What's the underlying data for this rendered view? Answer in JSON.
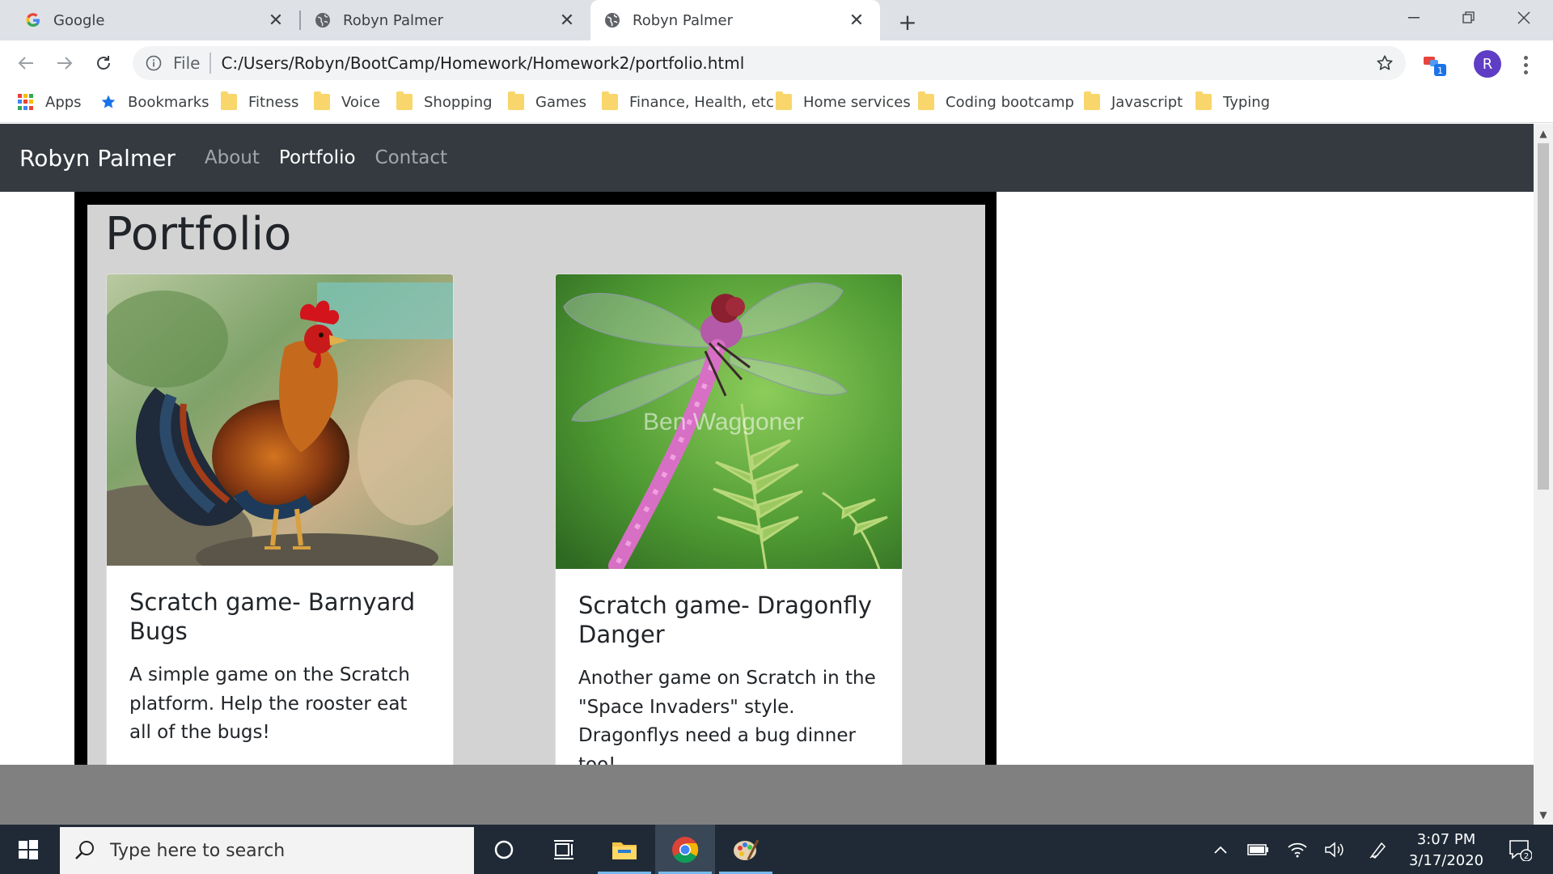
{
  "browser": {
    "tabs": [
      {
        "title": "Google",
        "favicon": "google-icon"
      },
      {
        "title": "Robyn Palmer",
        "favicon": "globe-icon"
      },
      {
        "title": "Robyn Palmer",
        "favicon": "globe-icon",
        "active": true
      }
    ],
    "address": {
      "scheme": "File",
      "url": "C:/Users/Robyn/BootCamp/Homework/Homework2/portfolio.html"
    },
    "profile_initial": "R",
    "extension_badge": "1",
    "bookmarks": [
      {
        "label": "Apps",
        "icon": "apps-grid-icon"
      },
      {
        "label": "Bookmarks",
        "icon": "star-icon"
      },
      {
        "label": "Fitness",
        "icon": "folder-icon"
      },
      {
        "label": "Voice",
        "icon": "folder-icon"
      },
      {
        "label": "Shopping",
        "icon": "folder-icon"
      },
      {
        "label": "Games",
        "icon": "folder-icon"
      },
      {
        "label": "Finance, Health, etc",
        "icon": "folder-icon"
      },
      {
        "label": "Home services",
        "icon": "folder-icon"
      },
      {
        "label": "Coding bootcamp",
        "icon": "folder-icon"
      },
      {
        "label": "Javascript",
        "icon": "folder-icon"
      },
      {
        "label": "Typing",
        "icon": "folder-icon"
      }
    ]
  },
  "site": {
    "brand": "Robyn Palmer",
    "nav": [
      {
        "label": "About"
      },
      {
        "label": "Portfolio",
        "active": true
      },
      {
        "label": "Contact"
      }
    ],
    "heading": "Portfolio",
    "cards": [
      {
        "image": "rooster-photo",
        "title": "Scratch game- Barnyard Bugs",
        "text": "A simple game on the Scratch platform. Help the rooster eat all of the bugs!"
      },
      {
        "image": "dragonfly-photo",
        "watermark": "Ben Waggoner",
        "title": "Scratch game- Dragonfly Danger",
        "text": "Another game on Scratch in the \"Space Invaders\" style. Dragonflys need a bug dinner too!"
      }
    ]
  },
  "taskbar": {
    "search_placeholder": "Type here to search",
    "time": "3:07 PM",
    "date": "3/17/2020",
    "notification_count": "2"
  },
  "colors": {
    "navbar": "#343a40",
    "panel": "#d3d3d3",
    "frame": "#000000",
    "band": "#808080",
    "taskbar": "#1f2a36"
  }
}
